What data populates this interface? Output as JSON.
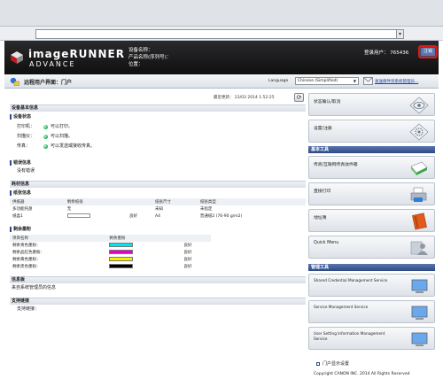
{
  "header": {
    "logo_title": "imageRUNNER",
    "logo_sub": "ADVANCE",
    "device_name_label": "设备名称：",
    "product_name_label": "产品名称(序列号)：",
    "location_label": "位置：",
    "login_user": "登录用户：  765436",
    "logout_label": "注销"
  },
  "portal": {
    "title": "远程用户界面：门户",
    "language_label": "Language",
    "language_value": "Chinese (Simplified)",
    "mail_link": "发送邮件到系统管理员..."
  },
  "status": {
    "last_updated": "最近更新：  23/03 2014 1:52:25",
    "device_basic_info": "设备基本信息",
    "device_status": "设备状态",
    "rows": [
      {
        "key": "打印机：",
        "value": "可以打印。"
      },
      {
        "key": "扫描仪：",
        "value": "可以扫描。"
      },
      {
        "key": "传真：",
        "value": "可以发送或接收传真。"
      }
    ],
    "error_info": "错误信息",
    "no_error": "没有错误"
  },
  "consumables": {
    "title": "耗材信息",
    "paper_info": "纸张信息",
    "paper_headers": [
      "供纸器",
      "剩余纸张",
      "纸张尺寸",
      "纸张类型"
    ],
    "paper_rows": [
      [
        "多功能托盘",
        "无",
        "",
        "未知",
        "未指定"
      ],
      [
        "纸盒1",
        "",
        "良好",
        "A4",
        "普通纸2 (76-90 g/m2)"
      ]
    ],
    "toner_info": "剩余墨粉",
    "toner_headers": [
      "项目名称",
      "剩余墨粉"
    ],
    "toner_rows": [
      {
        "name": "剩余青色墨粉：",
        "color": "#00e5f0",
        "status": "良好"
      },
      {
        "name": "剩余品红色墨粉：",
        "color": "#e800c8",
        "status": "良好"
      },
      {
        "name": "剩余黄色墨粉：",
        "color": "#f4ee00",
        "status": "良好"
      },
      {
        "name": "剩余黑色墨粉：",
        "color": "#000000",
        "status": "良好"
      }
    ]
  },
  "messages": {
    "title": "信息板",
    "text": "来自系统管理员的信息"
  },
  "support": {
    "title": "支持链接",
    "label": "支持链接："
  },
  "right": {
    "status_monitor": "状态确认/取消",
    "settings": "设置/注册",
    "basic_tools": "基本工具",
    "fax_address": "传真/互联网传真收件箱",
    "direct_print": "直接打印",
    "address_book": "地址簿",
    "quick_menu": "Quick Menu",
    "management_tools": "管理工具",
    "shared_credential": "Shared Credential Management Service",
    "service_management": "Service Management Service",
    "user_setting_1": "User Setting Information Management",
    "user_setting_2": "Service",
    "portal_settings": "门户显示设置",
    "copyright": "Copyright CANON INC. 2014 All Rights Reserved"
  }
}
